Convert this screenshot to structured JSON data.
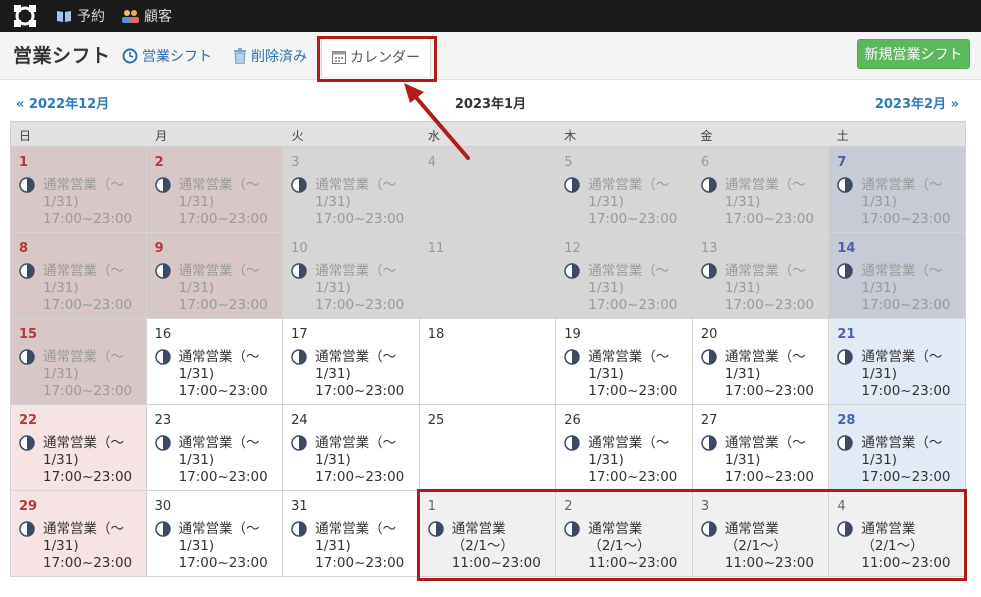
{
  "nav": {
    "logo_icon": "logo-icon",
    "items": [
      {
        "label": "予約",
        "icon": "book-icon"
      },
      {
        "label": "顧客",
        "icon": "users-icon"
      }
    ]
  },
  "subheader": {
    "title": "営業シフト",
    "tabs": [
      {
        "label": "営業シフト",
        "icon": "clock-icon"
      },
      {
        "label": "削除済み",
        "icon": "trash-icon"
      },
      {
        "label": "カレンダー",
        "icon": "calendar-icon",
        "active": true
      }
    ],
    "new_button": "新規営業シフト"
  },
  "month_nav": {
    "prev": "« 2022年12月",
    "current": "2023年1月",
    "next": "2023年2月 »"
  },
  "calendar": {
    "weekdays": [
      "日",
      "月",
      "火",
      "水",
      "木",
      "金",
      "土"
    ],
    "weeks": [
      [
        {
          "day": "1",
          "type": "sun",
          "state": "past",
          "ev": [
            "通常営業（〜",
            "1/31)",
            "17:00~23:00"
          ]
        },
        {
          "day": "2",
          "type": "sun",
          "state": "past",
          "ev": [
            "通常営業（〜",
            "1/31)",
            "17:00~23:00"
          ]
        },
        {
          "day": "3",
          "type": "",
          "state": "past",
          "ev": [
            "通常営業（〜",
            "1/31)",
            "17:00~23:00"
          ]
        },
        {
          "day": "4",
          "type": "",
          "state": "past",
          "ev": null
        },
        {
          "day": "5",
          "type": "",
          "state": "past",
          "ev": [
            "通常営業（〜",
            "1/31)",
            "17:00~23:00"
          ]
        },
        {
          "day": "6",
          "type": "",
          "state": "past",
          "ev": [
            "通常営業（〜",
            "1/31)",
            "17:00~23:00"
          ]
        },
        {
          "day": "7",
          "type": "sat",
          "state": "past",
          "ev": [
            "通常営業（〜",
            "1/31)",
            "17:00~23:00"
          ]
        }
      ],
      [
        {
          "day": "8",
          "type": "sun",
          "state": "past",
          "ev": [
            "通常営業（〜",
            "1/31)",
            "17:00~23:00"
          ]
        },
        {
          "day": "9",
          "type": "sun",
          "state": "past",
          "ev": [
            "通常営業（〜",
            "1/31)",
            "17:00~23:00"
          ]
        },
        {
          "day": "10",
          "type": "",
          "state": "past",
          "ev": [
            "通常営業（〜",
            "1/31)",
            "17:00~23:00"
          ]
        },
        {
          "day": "11",
          "type": "",
          "state": "past",
          "ev": null
        },
        {
          "day": "12",
          "type": "",
          "state": "past",
          "ev": [
            "通常営業（〜",
            "1/31)",
            "17:00~23:00"
          ]
        },
        {
          "day": "13",
          "type": "",
          "state": "past",
          "ev": [
            "通常営業（〜",
            "1/31)",
            "17:00~23:00"
          ]
        },
        {
          "day": "14",
          "type": "sat",
          "state": "past",
          "ev": [
            "通常営業（〜",
            "1/31)",
            "17:00~23:00"
          ]
        }
      ],
      [
        {
          "day": "15",
          "type": "sun",
          "state": "past",
          "ev": [
            "通常営業（〜",
            "1/31)",
            "17:00~23:00"
          ]
        },
        {
          "day": "16",
          "type": "",
          "state": "future",
          "ev": [
            "通常営業（〜",
            "1/31)",
            "17:00~23:00"
          ]
        },
        {
          "day": "17",
          "type": "",
          "state": "future",
          "ev": [
            "通常営業（〜",
            "1/31)",
            "17:00~23:00"
          ]
        },
        {
          "day": "18",
          "type": "",
          "state": "future",
          "ev": null
        },
        {
          "day": "19",
          "type": "",
          "state": "future",
          "ev": [
            "通常営業（〜",
            "1/31)",
            "17:00~23:00"
          ]
        },
        {
          "day": "20",
          "type": "",
          "state": "future",
          "ev": [
            "通常営業（〜",
            "1/31)",
            "17:00~23:00"
          ]
        },
        {
          "day": "21",
          "type": "sat",
          "state": "future",
          "ev": [
            "通常営業（〜",
            "1/31)",
            "17:00~23:00"
          ]
        }
      ],
      [
        {
          "day": "22",
          "type": "sun",
          "state": "future",
          "ev": [
            "通常営業（〜",
            "1/31)",
            "17:00~23:00"
          ]
        },
        {
          "day": "23",
          "type": "",
          "state": "future",
          "ev": [
            "通常営業（〜",
            "1/31)",
            "17:00~23:00"
          ]
        },
        {
          "day": "24",
          "type": "",
          "state": "future",
          "ev": [
            "通常営業（〜",
            "1/31)",
            "17:00~23:00"
          ]
        },
        {
          "day": "25",
          "type": "",
          "state": "future",
          "ev": null
        },
        {
          "day": "26",
          "type": "",
          "state": "future",
          "ev": [
            "通常営業（〜",
            "1/31)",
            "17:00~23:00"
          ]
        },
        {
          "day": "27",
          "type": "",
          "state": "future",
          "ev": [
            "通常営業（〜",
            "1/31)",
            "17:00~23:00"
          ]
        },
        {
          "day": "28",
          "type": "sat",
          "state": "future",
          "ev": [
            "通常営業（〜",
            "1/31)",
            "17:00~23:00"
          ]
        }
      ],
      [
        {
          "day": "29",
          "type": "sun",
          "state": "future",
          "ev": [
            "通常営業（〜",
            "1/31)",
            "17:00~23:00"
          ]
        },
        {
          "day": "30",
          "type": "",
          "state": "future",
          "ev": [
            "通常営業（〜",
            "1/31)",
            "17:00~23:00"
          ]
        },
        {
          "day": "31",
          "type": "",
          "state": "future",
          "ev": [
            "通常営業（〜",
            "1/31)",
            "17:00~23:00"
          ]
        },
        {
          "day": "1",
          "type": "",
          "state": "next",
          "ev": [
            "通常営業",
            "（2/1〜）",
            "11:00~23:00"
          ]
        },
        {
          "day": "2",
          "type": "",
          "state": "next",
          "ev": [
            "通常営業",
            "（2/1〜）",
            "11:00~23:00"
          ]
        },
        {
          "day": "3",
          "type": "",
          "state": "next",
          "ev": [
            "通常営業",
            "（2/1〜）",
            "11:00~23:00"
          ]
        },
        {
          "day": "4",
          "type": "",
          "state": "next",
          "ev": [
            "通常営業",
            "（2/1〜）",
            "11:00~23:00"
          ]
        }
      ]
    ]
  },
  "colors": {
    "topbar": "#1b1b1b",
    "link": "#2a7ac0",
    "button_green": "#5cb85c",
    "highlight": "#b01c1c"
  }
}
